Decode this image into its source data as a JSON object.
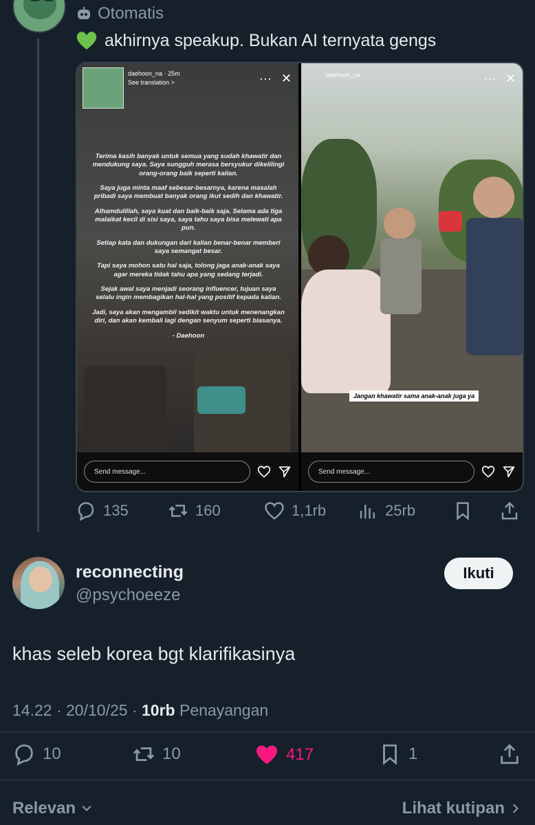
{
  "post": {
    "author_display": "Otomatis",
    "text": "akhirnya speakup. Bukan AI ternyata gengs",
    "stats": {
      "replies": "135",
      "reposts": "160",
      "likes": "1,1rb",
      "views": "25rb"
    }
  },
  "media": {
    "left_story": {
      "username": "daehoon_na",
      "time": "25m",
      "see_translation": "See translation >",
      "paragraphs": [
        "Terima kasih banyak untuk semua yang sudah khawatir dan mendukung saya. Saya sungguh merasa bersyukur dikelilingi orang-orang baik seperti kalian.",
        "Saya juga minta maaf sebesar-besarnya, karena masalah pribadi saya membuat banyak orang ikut sedih dan khawatir.",
        "Alhamdulillah, saya kuat dan baik-baik saja. Selama ada tiga malaikat kecil di sisi saya, saya tahu saya bisa melewati apa pun.",
        "Setiap kata dan dukungan dari kalian benar-benar memberi saya semangat besar.",
        "Tapi saya mohon satu hal saja, tolong jaga anak-anak saya agar mereka tidak tahu apa yang sedang terjadi.",
        "Sejak awal saya menjadi seorang influencer, tujuan saya selalu ingin membagikan hal-hal yang positif kepada kalian.",
        "Jadi, saya akan mengambil sedikit waktu untuk menenangkan diri, dan akan kembali lagi dengan senyum seperti biasanya.",
        "- Daehoon"
      ],
      "send_placeholder": "Send message..."
    },
    "right_story": {
      "username": "daehoon_na",
      "caption": "Jangan khawatir sama anak-anak juga ya",
      "send_placeholder": "Send message..."
    }
  },
  "reply": {
    "name": "reconnecting",
    "handle": "@psychoeeze",
    "follow_label": "Ikuti",
    "text": "khas seleb korea bgt klarifikasinya",
    "time": "14.22",
    "date": "20/10/25",
    "views_count": "10rb",
    "views_label": "Penayangan",
    "stats": {
      "replies": "10",
      "reposts": "10",
      "likes": "417",
      "bookmarks": "1"
    }
  },
  "footer": {
    "sort_label": "Relevan",
    "quotes_label": "Lihat kutipan"
  },
  "colors": {
    "bg": "#15202b",
    "muted": "#8b98a5",
    "like_active": "#f91880",
    "text": "#e7e9ea"
  }
}
